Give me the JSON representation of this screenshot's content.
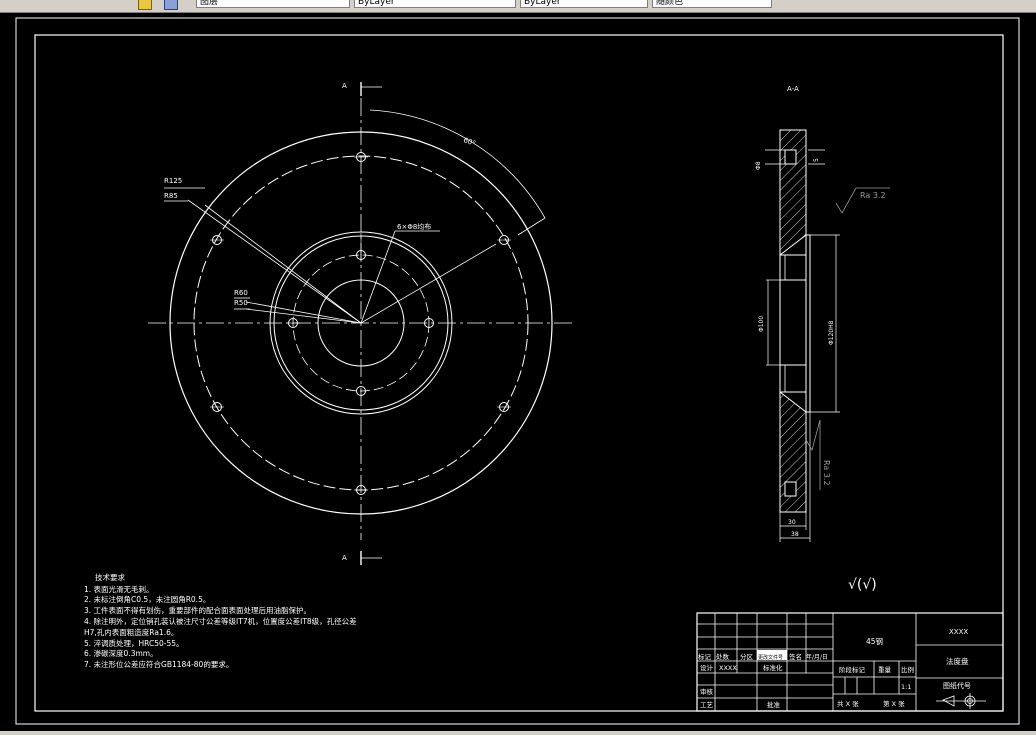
{
  "toolbar": {
    "layer_field": "图层",
    "linetype_field": "ByLayer",
    "lineweight_field": "ByLayer",
    "color_field": "随颜色"
  },
  "drawing": {
    "section_label_top": "A",
    "section_label_bottom": "A",
    "section_view_label": "A-A",
    "dim_r125": "R125",
    "dim_r85": "R85",
    "dim_r60": "R60",
    "dim_r50": "R50",
    "dim_angle": "60°",
    "dim_holes": "6×Φ8均布",
    "dim_phi8": "Φ8",
    "dim_depth": "5",
    "dim_phi100": "Φ100",
    "dim_phi120": "Φ120H8",
    "dim_30": "30",
    "dim_38": "38",
    "roughness_1": "Ra 3.2",
    "roughness_2": "Ra 3.2",
    "other_roughness": "√(√)"
  },
  "notes": {
    "title": "技术要求",
    "lines": [
      "1. 表面光滑无毛刺。",
      "2. 未标注倒角C0.5，未注圆角R0.5。",
      "3. 工件表面不得有划伤，重要部件的配合面表面处理后用油脂保护。",
      "4. 除注明外，定位销孔装认被注尺寸公差等级IT7机，位置度公差IT8级，孔径公差",
      "H7,孔内表面粗造度Ra1.6。",
      "5. 淬调质处理，HRC50-55。",
      "6. 渗碳深度0.3mm。",
      "7. 未注形位公差应符合GB1184-80的要求。"
    ]
  },
  "title_block": {
    "material": "45钢",
    "company": "XXXX",
    "part_name": "法度盘",
    "drawing_no_label": "图纸代号",
    "row_headers": [
      "标记",
      "处数",
      "分区",
      "更改文件号",
      "签名",
      "年/月/日"
    ],
    "designer_label": "设计",
    "designer": "XXXX",
    "standardize_label": "标准化",
    "stage_label": "阶段标记",
    "weight_label": "重量",
    "scale_label": "比例",
    "scale": "1:1",
    "check_label": "审核",
    "process_label": "工艺",
    "approve_label": "批准",
    "sheets_total": "共 X 张",
    "sheet_no": "第 X 张"
  },
  "colors": {
    "background": "#000000",
    "line": "#ffffff",
    "dim": "#c8c8c8",
    "roughness": "#9a9a9a"
  }
}
